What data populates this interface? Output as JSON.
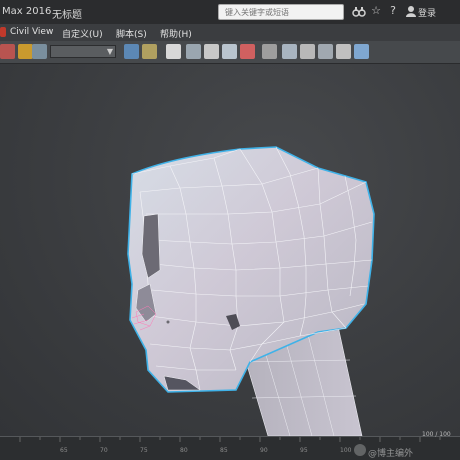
{
  "titlebar": {
    "app_title": "Max 2016",
    "doc_title": "无标题",
    "search_placeholder": "键入关键字或短语",
    "login_label": "登录",
    "icons": [
      "binoculars-icon",
      "star-icon",
      "user-icon"
    ]
  },
  "menubar": {
    "items": [
      "Civil View",
      "自定义(U)",
      "脚本(S)",
      "帮助(H)"
    ]
  },
  "toolbar": {
    "selection_set_value": ""
  },
  "timeline": {
    "frame_counter": "100 / 100",
    "frame_labels": [
      "65",
      "70",
      "75",
      "80",
      "85",
      "90",
      "95",
      "100"
    ]
  },
  "watermark": {
    "text": "@博主编外"
  }
}
